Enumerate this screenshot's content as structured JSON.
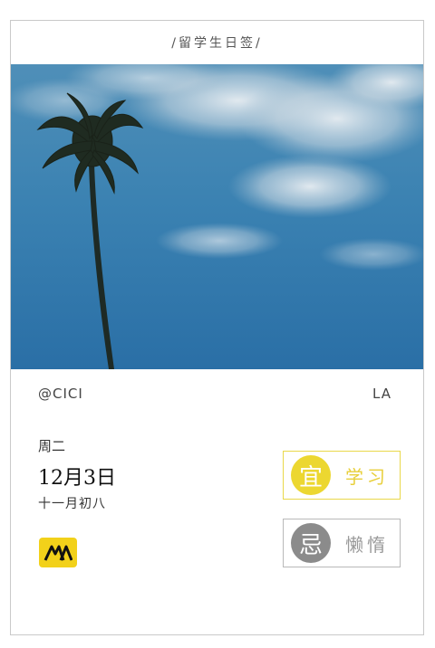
{
  "header": {
    "title": "/留学生日签/"
  },
  "meta": {
    "author": "@CICI",
    "location": "LA"
  },
  "date": {
    "weekday": "周二",
    "gregorian": "12月3日",
    "lunar": "十一月初八"
  },
  "advice": {
    "good": {
      "char": "宜",
      "text": "学习",
      "color": "#ecd730"
    },
    "bad": {
      "char": "忌",
      "text": "懒惰",
      "color": "#8b8b8b"
    }
  },
  "logo": {
    "text": "MA",
    "color": "#f2d11a"
  },
  "photo": {
    "subject": "palm tree against blue sky with clouds"
  }
}
